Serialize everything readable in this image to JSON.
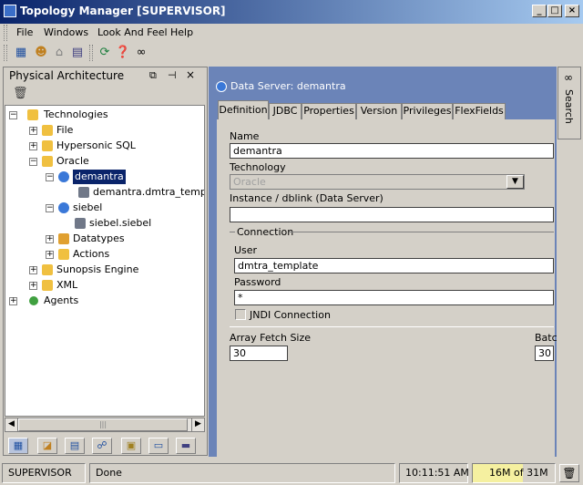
{
  "window": {
    "title": "Topology Manager [SUPERVISOR]",
    "controls": [
      "_",
      "□",
      "×"
    ]
  },
  "menu": {
    "items": [
      "File",
      "Windows",
      "Look And Feel",
      "Help"
    ]
  },
  "toolbar": {
    "icons": [
      "topology-icon",
      "user-icon",
      "security-icon",
      "report-icon",
      "refresh-icon",
      "help-icon",
      "binoculars-icon"
    ]
  },
  "left_panel": {
    "title": "Physical Architecture",
    "header_buttons": [
      "⧉",
      "⊣",
      "×"
    ],
    "tree": [
      {
        "label": "Technologies",
        "expander": "−"
      },
      {
        "label": "File",
        "expander": "+"
      },
      {
        "label": "Hypersonic SQL",
        "expander": "+"
      },
      {
        "label": "Oracle",
        "expander": "−"
      },
      {
        "label": "demantra",
        "expander": "−"
      },
      {
        "label": "demantra.dmtra_template",
        "expander": ""
      },
      {
        "label": "siebel",
        "expander": "−"
      },
      {
        "label": "siebel.siebel",
        "expander": ""
      },
      {
        "label": "Datatypes",
        "expander": "+"
      },
      {
        "label": "Actions",
        "expander": "+"
      },
      {
        "label": "Sunopsis Engine",
        "expander": "+"
      },
      {
        "label": "XML",
        "expander": "+"
      },
      {
        "label": "Agents",
        "expander": "+"
      }
    ],
    "scroll_thumb": "|||"
  },
  "detail": {
    "header": "Data Server: demantra",
    "tabs": [
      "Definition",
      "JDBC",
      "Properties",
      "Version",
      "Privileges",
      "FlexFields"
    ],
    "fields": {
      "name_label": "Name",
      "name_value": "demantra",
      "technology_label": "Technology",
      "technology_value": "Oracle",
      "instance_label": "Instance / dblink (Data Server)",
      "instance_value": "",
      "connection_label": "Connection",
      "user_label": "User",
      "user_value": "dmtra_template",
      "password_label": "Password",
      "password_value": "*",
      "jndi_label": "JNDI Connection",
      "fetch_label": "Array Fetch Size",
      "fetch_value": "30",
      "batch_label": "Batc",
      "batch_value": "30"
    }
  },
  "side_tab": {
    "label": "Search"
  },
  "status": {
    "user": "SUPERVISOR",
    "message": "Done",
    "time": "10:11:51 AM",
    "memory": "16M of 31M"
  },
  "colors": {
    "title_start": "#0a246a",
    "title_end": "#a6caf0",
    "panel_blue": "#6b84b8",
    "memory_bg": "#f5f0a0"
  }
}
